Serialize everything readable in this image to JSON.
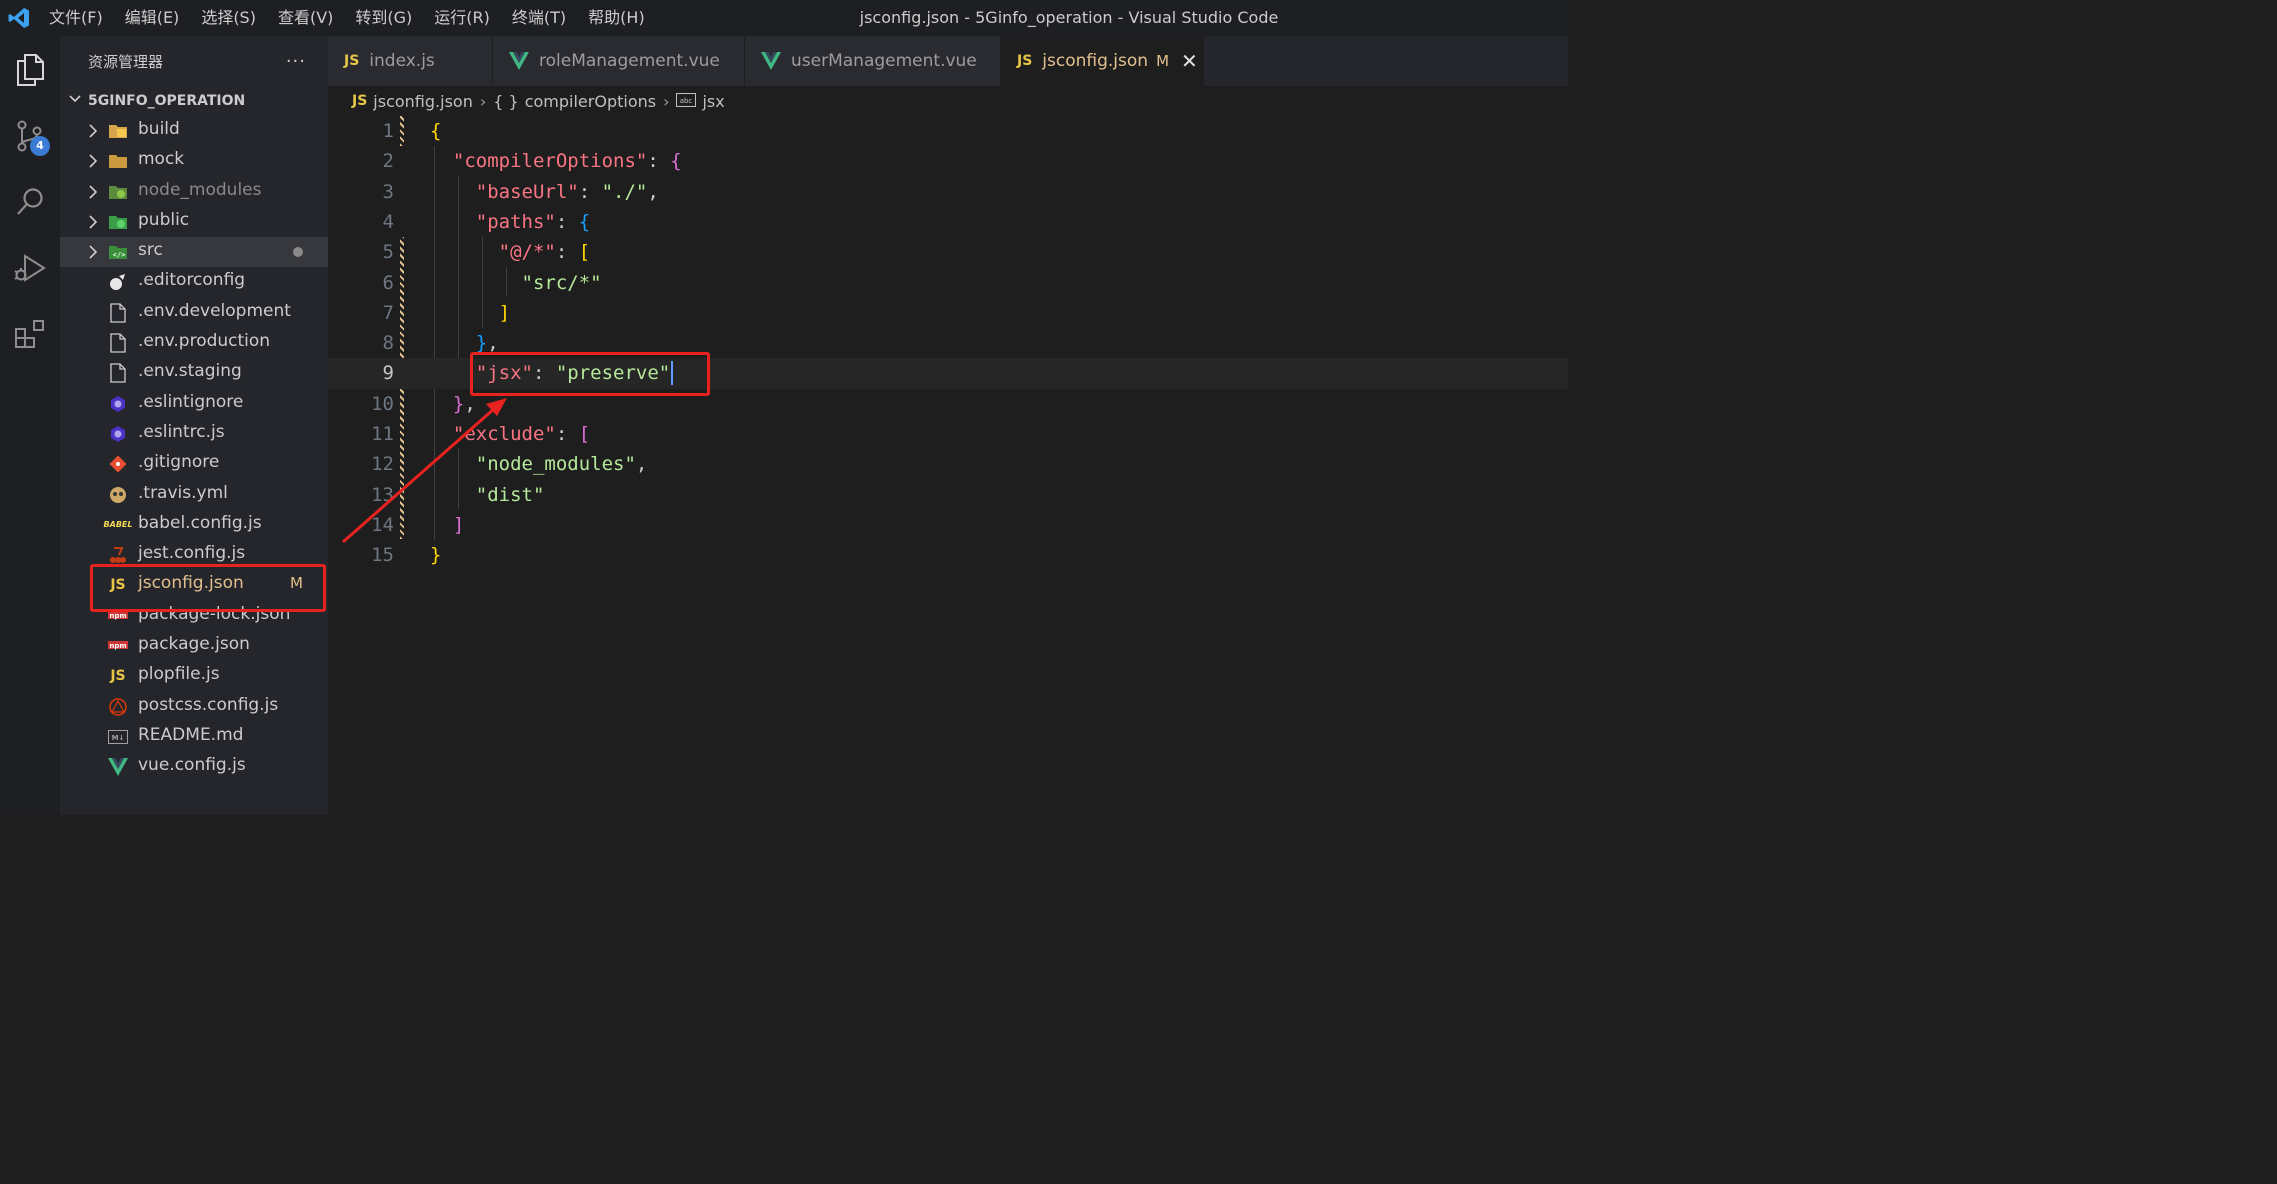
{
  "titlebar": {
    "menu": [
      "文件(F)",
      "编辑(E)",
      "选择(S)",
      "查看(V)",
      "转到(G)",
      "运行(R)",
      "终端(T)",
      "帮助(H)"
    ],
    "window_title": "jsconfig.json - 5Ginfo_operation - Visual Studio Code"
  },
  "activitybar": {
    "items": [
      "explorer-icon",
      "source-control-icon",
      "search-icon",
      "run-debug-icon",
      "extensions-icon"
    ],
    "source_control_badge": "4"
  },
  "sidebar": {
    "title": "资源管理器",
    "more": "···",
    "section": "5GINFO_OPERATION",
    "items": [
      {
        "label": "build",
        "type": "folder",
        "icon": "build-folder-icon"
      },
      {
        "label": "mock",
        "type": "folder",
        "icon": "folder-icon"
      },
      {
        "label": "node_modules",
        "type": "folder",
        "icon": "node-folder-icon",
        "dimmed": true
      },
      {
        "label": "public",
        "type": "folder",
        "icon": "public-folder-icon"
      },
      {
        "label": "src",
        "type": "folder",
        "icon": "src-folder-icon",
        "selected": true,
        "dot": true
      },
      {
        "label": ".editorconfig",
        "icon": "editorconfig-icon"
      },
      {
        "label": ".env.development",
        "icon": "file-icon"
      },
      {
        "label": ".env.production",
        "icon": "file-icon"
      },
      {
        "label": ".env.staging",
        "icon": "file-icon"
      },
      {
        "label": ".eslintignore",
        "icon": "eslint-icon"
      },
      {
        "label": ".eslintrc.js",
        "icon": "eslint-icon"
      },
      {
        "label": ".gitignore",
        "icon": "git-icon"
      },
      {
        "label": ".travis.yml",
        "icon": "travis-icon"
      },
      {
        "label": "babel.config.js",
        "icon": "babel-icon"
      },
      {
        "label": "jest.config.js",
        "icon": "jest-icon"
      },
      {
        "label": "jsconfig.json",
        "icon": "jsconfig-icon",
        "badge": "M",
        "modified": true
      },
      {
        "label": "package-lock.json",
        "icon": "npm-icon"
      },
      {
        "label": "package.json",
        "icon": "npm-icon"
      },
      {
        "label": "plopfile.js",
        "icon": "js-icon"
      },
      {
        "label": "postcss.config.js",
        "icon": "postcss-icon"
      },
      {
        "label": "README.md",
        "icon": "markdown-icon"
      },
      {
        "label": "vue.config.js",
        "icon": "vue-icon"
      }
    ]
  },
  "tabs": [
    {
      "label": "index.js",
      "icon": "js-icon"
    },
    {
      "label": "roleManagement.vue",
      "icon": "vue-icon"
    },
    {
      "label": "userManagement.vue",
      "icon": "vue-icon"
    },
    {
      "label": "jsconfig.json",
      "icon": "js-icon",
      "active": true,
      "badge": "M",
      "close": "✕"
    }
  ],
  "breadcrumb": [
    "jsconfig.json",
    "compilerOptions",
    "jsx"
  ],
  "editor": {
    "current_line": 9,
    "lines": [
      [
        [
          "b1",
          "{"
        ]
      ],
      [
        [
          "p",
          "  "
        ],
        [
          "k",
          "\"compilerOptions\""
        ],
        [
          "p",
          ": "
        ],
        [
          "b2",
          "{"
        ]
      ],
      [
        [
          "p",
          "    "
        ],
        [
          "k",
          "\"baseUrl\""
        ],
        [
          "p",
          ": "
        ],
        [
          "s",
          "\"./\""
        ],
        [
          "p",
          ","
        ]
      ],
      [
        [
          "p",
          "    "
        ],
        [
          "k",
          "\"paths\""
        ],
        [
          "p",
          ": "
        ],
        [
          "b3",
          "{"
        ]
      ],
      [
        [
          "p",
          "      "
        ],
        [
          "k",
          "\"@/*\""
        ],
        [
          "p",
          ": "
        ],
        [
          "b1",
          "["
        ]
      ],
      [
        [
          "p",
          "        "
        ],
        [
          "s",
          "\"src/*\""
        ]
      ],
      [
        [
          "p",
          "      "
        ],
        [
          "b1",
          "]"
        ]
      ],
      [
        [
          "p",
          "    "
        ],
        [
          "b3",
          "}"
        ],
        [
          "p",
          ","
        ]
      ],
      [
        [
          "p",
          "    "
        ],
        [
          "k",
          "\"jsx\""
        ],
        [
          "p",
          ": "
        ],
        [
          "s",
          "\"preserve\""
        ]
      ],
      [
        [
          "p",
          "  "
        ],
        [
          "b2",
          "}"
        ],
        [
          "p",
          ","
        ]
      ],
      [
        [
          "p",
          "  "
        ],
        [
          "k",
          "\"exclude\""
        ],
        [
          "p",
          ": "
        ],
        [
          "b2",
          "["
        ]
      ],
      [
        [
          "p",
          "    "
        ],
        [
          "s",
          "\"node_modules\""
        ],
        [
          "p",
          ","
        ]
      ],
      [
        [
          "p",
          "    "
        ],
        [
          "s",
          "\"dist\""
        ]
      ],
      [
        [
          "p",
          "  "
        ],
        [
          "b2",
          "]"
        ]
      ],
      [
        [
          "b1",
          "}"
        ]
      ]
    ]
  },
  "annotation": {
    "color": "#e8231f"
  }
}
